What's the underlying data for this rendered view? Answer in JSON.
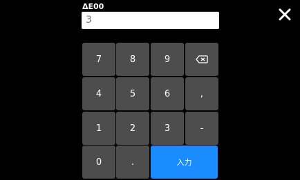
{
  "field": {
    "label": "ΔE00",
    "value": "3"
  },
  "icons": {
    "close": "close-icon",
    "backspace": "backspace-icon"
  },
  "keypad": {
    "k7": "7",
    "k8": "8",
    "k9": "9",
    "k4": "4",
    "k5": "5",
    "k6": "6",
    "comma": ",",
    "k1": "1",
    "k2": "2",
    "k3": "3",
    "minus": "-",
    "k0": "0",
    "dot": ".",
    "enter": "入力"
  },
  "colors": {
    "background": "#000000",
    "key": "#4d4d4d",
    "enter": "#1a8cff",
    "input": "#ffffff",
    "text": "#ffffff"
  }
}
